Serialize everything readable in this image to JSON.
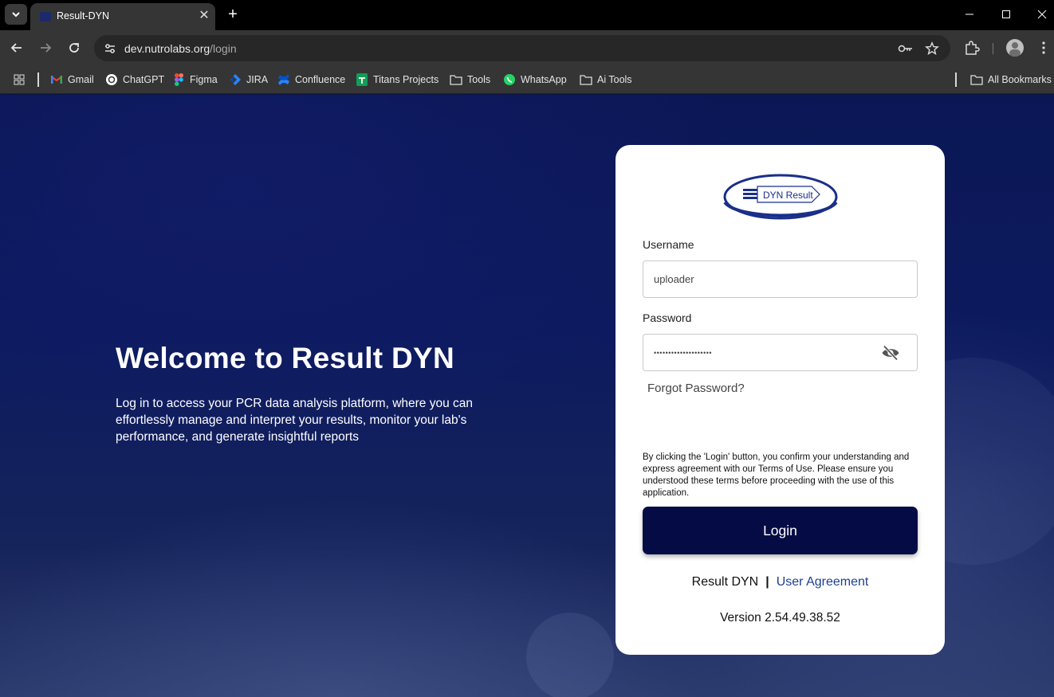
{
  "browser": {
    "tab_title": "Result-DYN",
    "url_host": "dev.nutrolabs.org",
    "url_path": "/login",
    "bookmarks": [
      {
        "label": "Gmail",
        "icon": "gmail-icon"
      },
      {
        "label": "ChatGPT",
        "icon": "chatgpt-icon"
      },
      {
        "label": "Figma",
        "icon": "figma-icon"
      },
      {
        "label": "JIRA",
        "icon": "jira-icon"
      },
      {
        "label": "Confluence",
        "icon": "confluence-icon"
      },
      {
        "label": "Titans Projects",
        "icon": "sheets-icon"
      },
      {
        "label": "Tools",
        "icon": "folder-icon"
      },
      {
        "label": "WhatsApp",
        "icon": "whatsapp-icon"
      },
      {
        "label": "Ai Tools",
        "icon": "folder-icon"
      }
    ],
    "all_bookmarks": "All Bookmarks"
  },
  "welcome": {
    "title": "Welcome to Result DYN",
    "text": "Log in to access your PCR data analysis platform, where you can effortlessly manage and interpret your results, monitor your lab's performance, and generate insightful reports"
  },
  "login": {
    "logo_text": "DYN Result",
    "username_label": "Username",
    "username_value": "uploader",
    "password_label": "Password",
    "password_value": "••••••••••••••••••••",
    "forgot": "Forgot Password?",
    "terms": "By clicking the 'Login' button, you confirm your understanding and express agreement with our Terms of Use. Please ensure you understood these terms before proceeding with the use of this application.",
    "button": "Login",
    "footer_brand": "Result DYN",
    "footer_separator": "|",
    "footer_link": "User Agreement",
    "version": "Version 2.54.49.38.52"
  },
  "colors": {
    "button": "#050c45",
    "link": "#1f3f8f",
    "background": "#0c1a5e"
  }
}
